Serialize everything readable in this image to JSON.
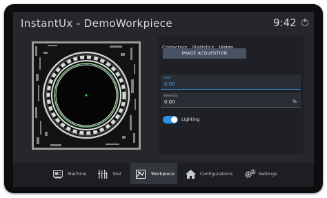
{
  "app": {
    "title": "InstantUx - DemoWorkpiece",
    "clock": "9:42"
  },
  "panel": {
    "tabs": [
      {
        "label": "Correctors",
        "active": false
      },
      {
        "label": "Statistics",
        "active": false
      },
      {
        "label": "Vision",
        "active": true
      }
    ],
    "acquisition_button": "IMAGE ACQUISITION",
    "gain": {
      "label": "Gain",
      "value": "0.00"
    },
    "intensity": {
      "label": "Intensity",
      "value": "0.00",
      "unit": "%"
    },
    "lighting": {
      "label": "Lighting",
      "on": true
    }
  },
  "nav": {
    "items": [
      {
        "label": "Machine",
        "icon": "machine-icon",
        "active": false
      },
      {
        "label": "Tool",
        "icon": "tool-icon",
        "active": false
      },
      {
        "label": "Workpiece",
        "icon": "workpiece-icon",
        "active": true
      },
      {
        "label": "Configurations",
        "icon": "home-icon",
        "active": false
      },
      {
        "label": "Settings",
        "icon": "gears-icon",
        "active": false
      }
    ]
  },
  "colors": {
    "accent": "#2f8fe0",
    "background": "#25272d",
    "panel": "#1e2025",
    "nav": "#1c1e22"
  }
}
